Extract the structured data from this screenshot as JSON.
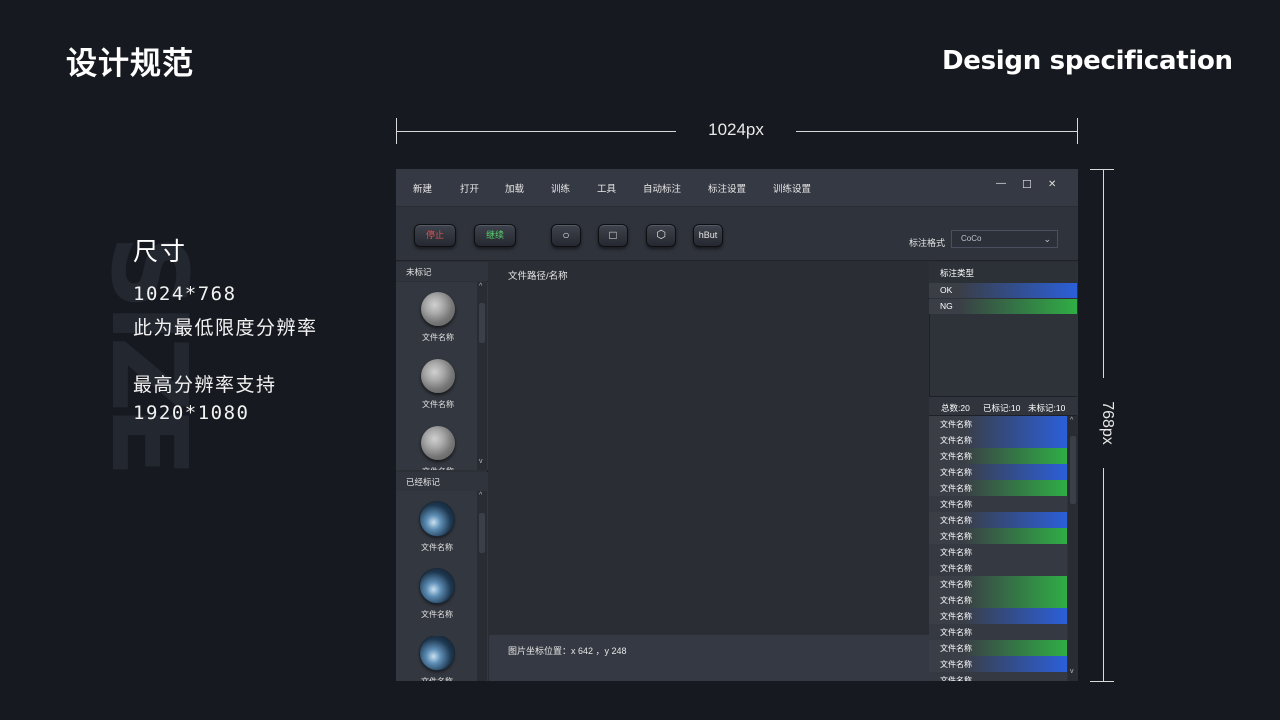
{
  "header": {
    "title_cn": "设计规范",
    "title_en": "Design specification"
  },
  "spec": {
    "heading": "尺寸",
    "size": "1024*768",
    "min_note": "此为最低限度分辨率",
    "max_label": "最高分辨率支持",
    "max_size": "1920*1080",
    "watermark": "SIZE"
  },
  "dimensions": {
    "width_label": "1024px",
    "height_label": "768px"
  },
  "app": {
    "menu": [
      "新建",
      "打开",
      "加载",
      "训练",
      "工具",
      "自动标注",
      "标注设置",
      "训练设置"
    ],
    "window_controls": {
      "minimize": "—",
      "maximize": "☐",
      "close": "✕"
    },
    "toolbar": {
      "stop": "停止",
      "continue": "继续",
      "circle_tool": "○",
      "rect_tool": "□",
      "polygon_tool": "⬡",
      "hbut": "hBut",
      "format_label": "标注格式",
      "format_value": "CoCo",
      "format_chevron": "⌄"
    },
    "left": {
      "unlabeled_header": "未标记",
      "labeled_header": "已经标记",
      "thumb_label": "文件名称"
    },
    "center": {
      "path_label": "文件路径/名称",
      "coord_text": "图片坐标位置：x 642 ，y 248"
    },
    "right": {
      "type_header": "标注类型",
      "types": [
        {
          "name": "OK",
          "color": "#2b5fd9"
        },
        {
          "name": "NG",
          "color": "#2fae45"
        }
      ],
      "stats": {
        "total": "总数:20",
        "labeled": "已标记:10",
        "unlabeled": "未标记:10"
      },
      "file_label": "文件名称",
      "file_rows": [
        "blue",
        "blue",
        "green",
        "blue",
        "green",
        "none",
        "blue",
        "green",
        "none",
        "none",
        "green",
        "green",
        "blue",
        "none",
        "green",
        "blue",
        "none"
      ]
    },
    "scroll": {
      "up": "^",
      "down": "v"
    }
  },
  "colors": {
    "background": "#16191f",
    "ok": "#2b5fd9",
    "ng": "#2fae45",
    "stop_text": "#e05252",
    "continue_text": "#59d06a"
  }
}
